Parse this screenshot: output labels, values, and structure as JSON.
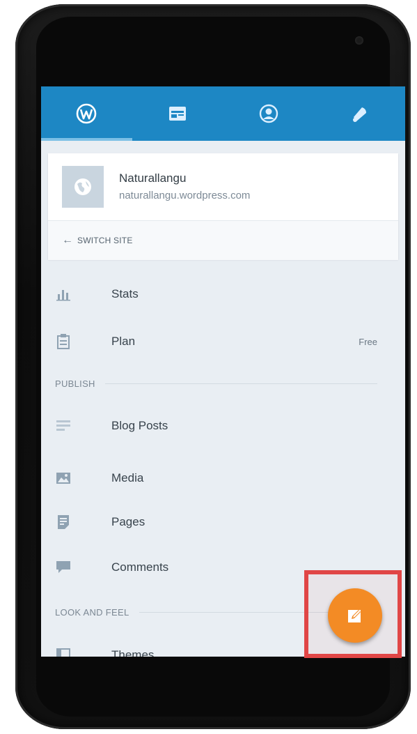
{
  "tabs": [
    {
      "name": "my-sites",
      "icon": "wordpress-icon",
      "active": true
    },
    {
      "name": "reader",
      "icon": "reader-icon",
      "active": false
    },
    {
      "name": "me",
      "icon": "profile-icon",
      "active": false
    },
    {
      "name": "notifications",
      "icon": "bell-icon",
      "active": false
    }
  ],
  "site": {
    "title": "Naturallangu",
    "url": "naturallangu.wordpress.com",
    "avatar_icon": "globe-icon"
  },
  "switch_site": {
    "arrow": "←",
    "label": "SWITCH SITE"
  },
  "menu": {
    "stats": "Stats",
    "plan": "Plan",
    "plan_badge": "Free",
    "publish_header": "PUBLISH",
    "blog_posts": "Blog Posts",
    "media": "Media",
    "pages": "Pages",
    "comments": "Comments",
    "look_header": "LOOK AND FEEL",
    "themes": "Themes"
  },
  "fab": {
    "icon": "edit-icon",
    "accent": "#f38b25"
  },
  "colors": {
    "topbar": "#1d87c4",
    "background": "#e9eef3",
    "highlight": "#e04646"
  }
}
